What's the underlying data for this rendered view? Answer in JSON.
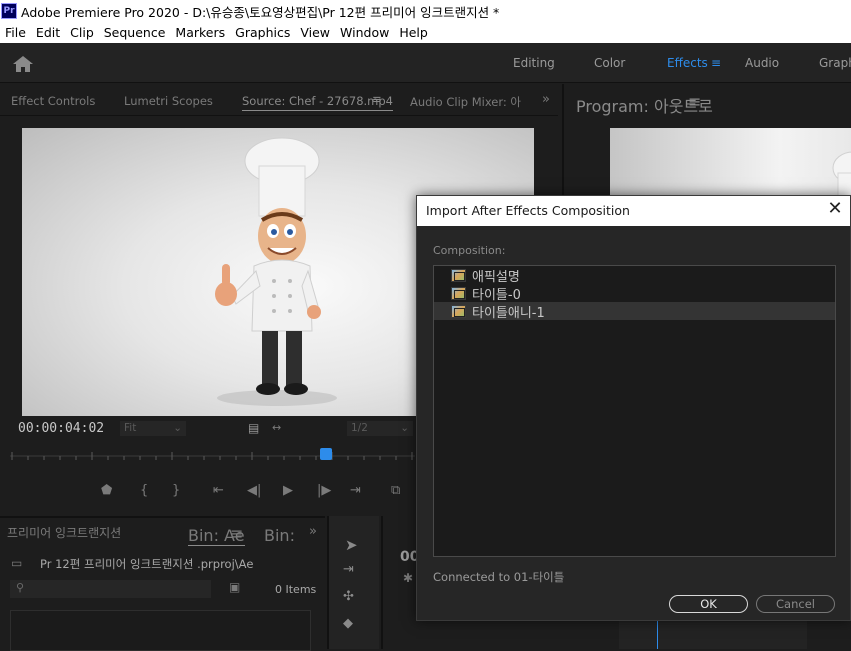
{
  "window": {
    "title": "Adobe Premiere Pro 2020 - D:\\유승종\\토요영상편집\\Pr 12편 프리미어 잉크트랜지션  *",
    "app_icon": "Pr"
  },
  "menu": [
    "File",
    "Edit",
    "Clip",
    "Sequence",
    "Markers",
    "Graphics",
    "View",
    "Window",
    "Help"
  ],
  "workspaces": {
    "editing": "Editing",
    "color": "Color",
    "effects": "Effects",
    "audio": "Audio",
    "graphics": "Graphi",
    "active": "Effects"
  },
  "source_panel": {
    "tabs": [
      "Effect Controls",
      "Lumetri Scopes",
      "Source: Chef - 27678.mp4",
      "Audio Clip Mixer: 아! "
    ],
    "overflow": "»",
    "timecode": "00:00:04:02",
    "zoom": "Fit",
    "resolution": "1/2"
  },
  "program_panel": {
    "tab": "Program: 아웃트로"
  },
  "project_panel": {
    "tabs": [
      "프리미어 잉크트랜지션",
      "Bin: Ae",
      "Bin:"
    ],
    "path": "Pr 12편 프리미어 잉크트랜지션 .prproj\\Ae",
    "items_count": "0 Items"
  },
  "timeline_panel": {
    "timecode_partial": "00"
  },
  "dialog": {
    "title": "Import After Effects Composition",
    "composition_label": "Composition:",
    "items": [
      {
        "name": "애픽설명",
        "selected": false
      },
      {
        "name": "타이틀-0",
        "selected": false
      },
      {
        "name": "타이틀애니-1",
        "selected": true
      }
    ],
    "connected": "Connected to 01-타이틀",
    "ok_label": "OK",
    "cancel_label": "Cancel",
    "close_label": "✕"
  },
  "colors": {
    "accent": "#2d8ceb",
    "panel_bg": "#1d1d1d",
    "dialog_bg": "#262626"
  }
}
